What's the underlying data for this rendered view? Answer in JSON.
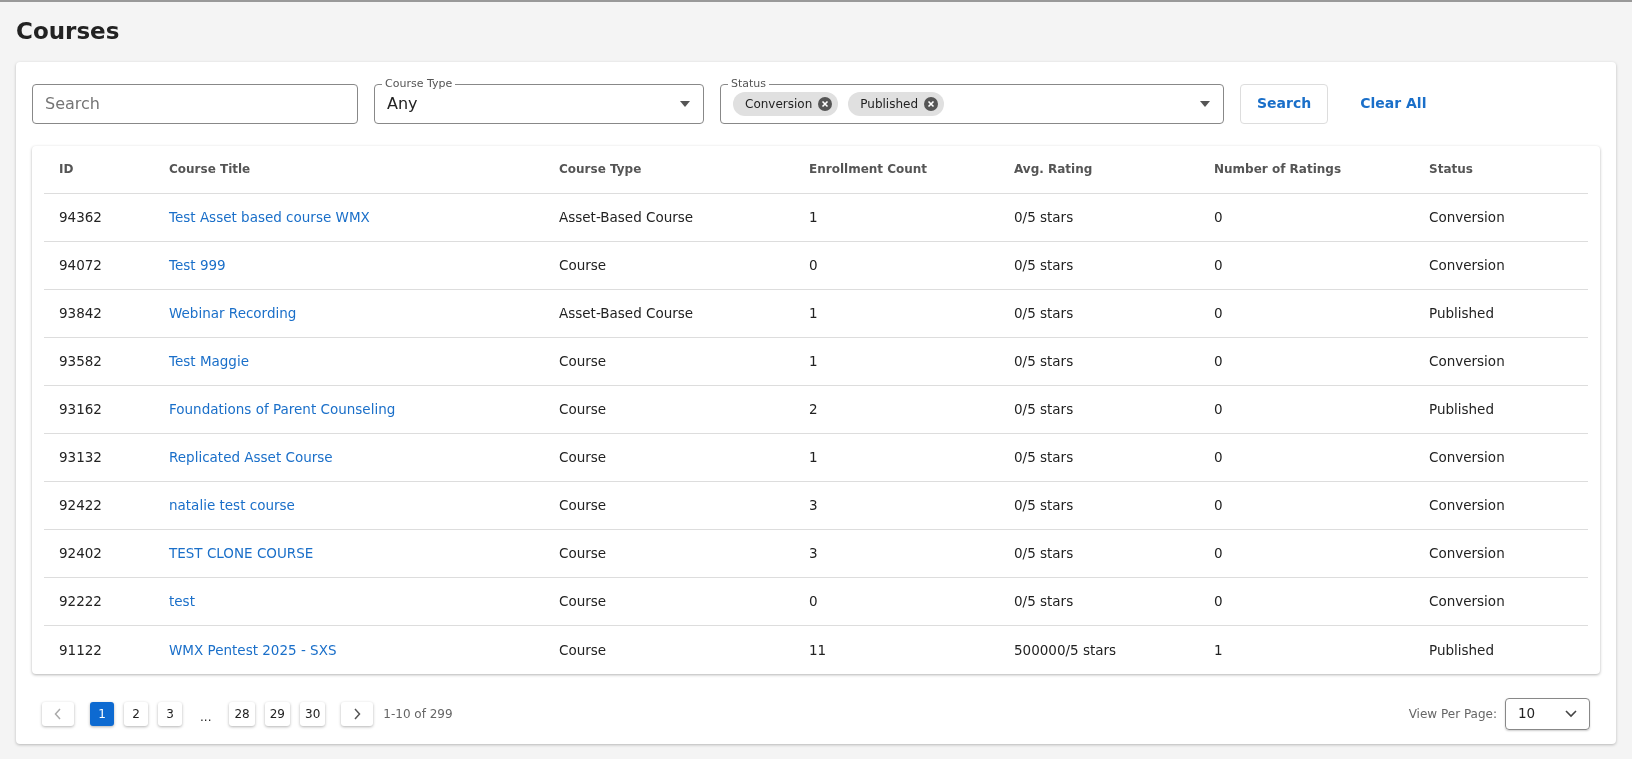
{
  "page_title": "Courses",
  "filters": {
    "search": {
      "placeholder": "Search"
    },
    "course_type": {
      "label": "Course Type",
      "value": "Any"
    },
    "status": {
      "label": "Status",
      "chips": [
        "Conversion",
        "Published"
      ]
    },
    "search_button": "Search",
    "clear_button": "Clear All"
  },
  "table": {
    "columns": [
      "ID",
      "Course Title",
      "Course Type",
      "Enrollment Count",
      "Avg. Rating",
      "Number of Ratings",
      "Status"
    ],
    "rows": [
      [
        "94362",
        "Test Asset based course WMX",
        "Asset-Based Course",
        "1",
        "0/5 stars",
        "0",
        "Conversion"
      ],
      [
        "94072",
        "Test 999",
        "Course",
        "0",
        "0/5 stars",
        "0",
        "Conversion"
      ],
      [
        "93842",
        "Webinar Recording",
        "Asset-Based Course",
        "1",
        "0/5 stars",
        "0",
        "Published"
      ],
      [
        "93582",
        "Test Maggie",
        "Course",
        "1",
        "0/5 stars",
        "0",
        "Conversion"
      ],
      [
        "93162",
        "Foundations of Parent Counseling",
        "Course",
        "2",
        "0/5 stars",
        "0",
        "Published"
      ],
      [
        "93132",
        "Replicated Asset Course",
        "Course",
        "1",
        "0/5 stars",
        "0",
        "Conversion"
      ],
      [
        "92422",
        "natalie test course",
        "Course",
        "3",
        "0/5 stars",
        "0",
        "Conversion"
      ],
      [
        "92402",
        "TEST CLONE COURSE",
        "Course",
        "3",
        "0/5 stars",
        "0",
        "Conversion"
      ],
      [
        "92222",
        "test",
        "Course",
        "0",
        "0/5 stars",
        "0",
        "Conversion"
      ],
      [
        "91122",
        "WMX Pentest 2025 - SXS",
        "Course",
        "11",
        "500000/5 stars",
        "1",
        "Published"
      ]
    ]
  },
  "pagination": {
    "pages": [
      {
        "label": "1",
        "selected": true
      },
      {
        "label": "2",
        "selected": false
      },
      {
        "label": "3",
        "selected": false
      },
      {
        "label": "...",
        "kind": "ellipsis"
      },
      {
        "label": "28",
        "selected": false
      },
      {
        "label": "29",
        "selected": false
      },
      {
        "label": "30",
        "selected": false
      }
    ],
    "range": "1-10 of 299",
    "per_page_label": "View Per Page:",
    "per_page": "10"
  }
}
